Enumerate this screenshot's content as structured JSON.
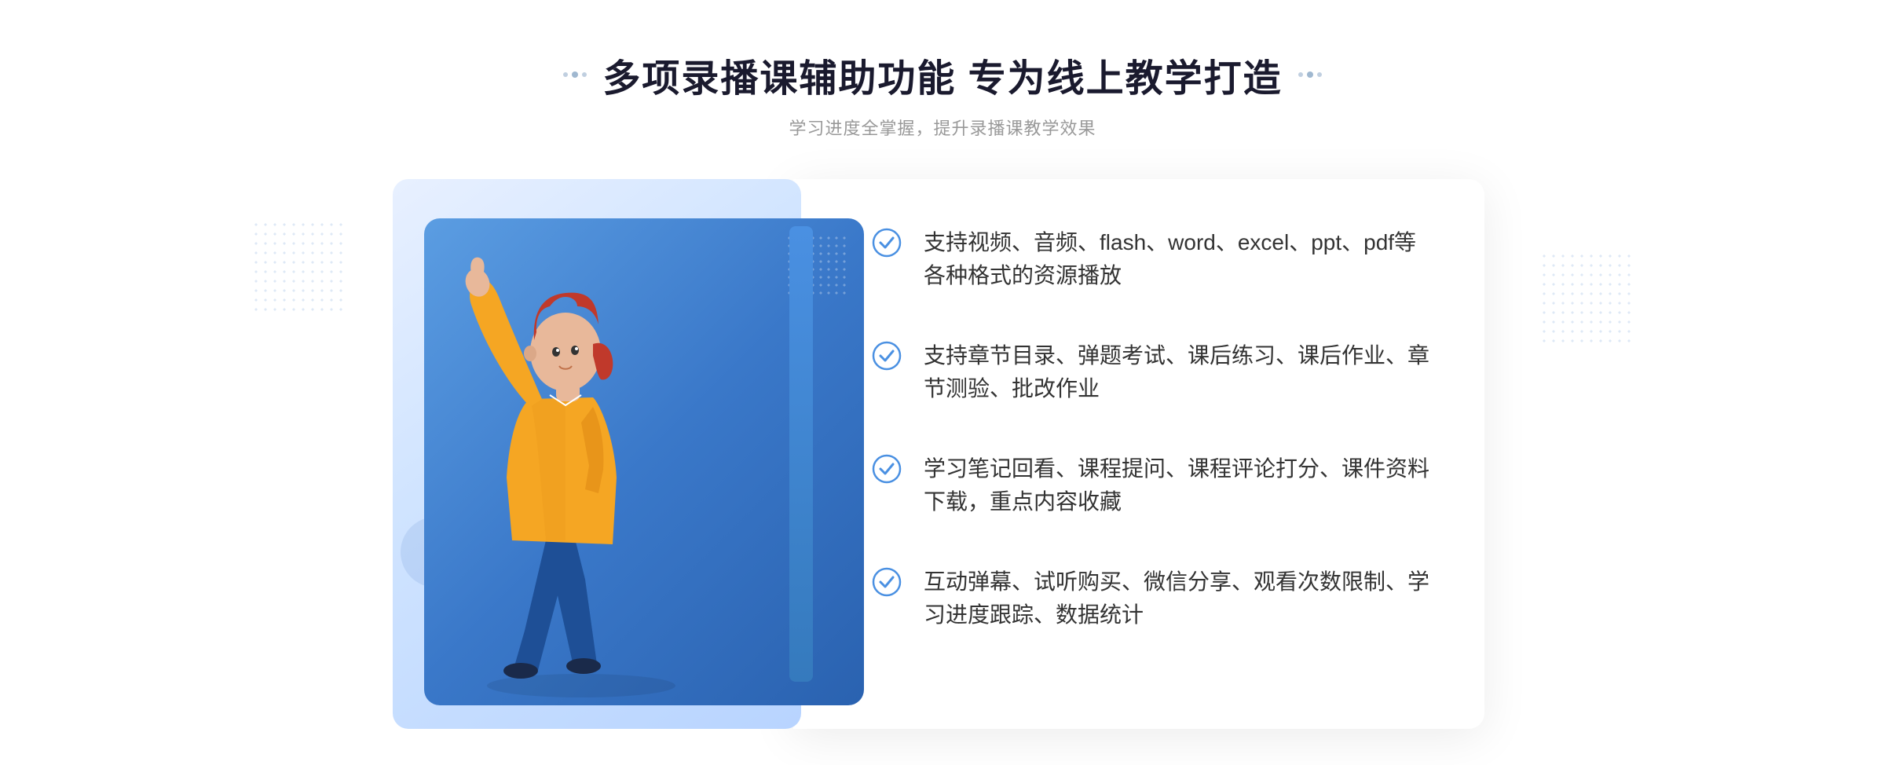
{
  "header": {
    "title": "多项录播课辅助功能 专为线上教学打造",
    "subtitle": "学习进度全掌握，提升录播课教学效果",
    "title_dots_left": "decorative",
    "title_dots_right": "decorative"
  },
  "features": [
    {
      "id": 1,
      "text": "支持视频、音频、flash、word、excel、ppt、pdf等各种格式的资源播放"
    },
    {
      "id": 2,
      "text": "支持章节目录、弹题考试、课后练习、课后作业、章节测验、批改作业"
    },
    {
      "id": 3,
      "text": "学习笔记回看、课程提问、课程评论打分、课件资料下载，重点内容收藏"
    },
    {
      "id": 4,
      "text": "互动弹幕、试听购买、微信分享、观看次数限制、学习进度跟踪、数据统计"
    }
  ],
  "colors": {
    "primary_blue": "#4a90e2",
    "dark_blue": "#2a62b0",
    "light_blue_bg": "#e8f2ff",
    "text_dark": "#333333",
    "text_title": "#1a1a2e",
    "text_subtitle": "#999999",
    "check_color": "#4a90e2"
  }
}
